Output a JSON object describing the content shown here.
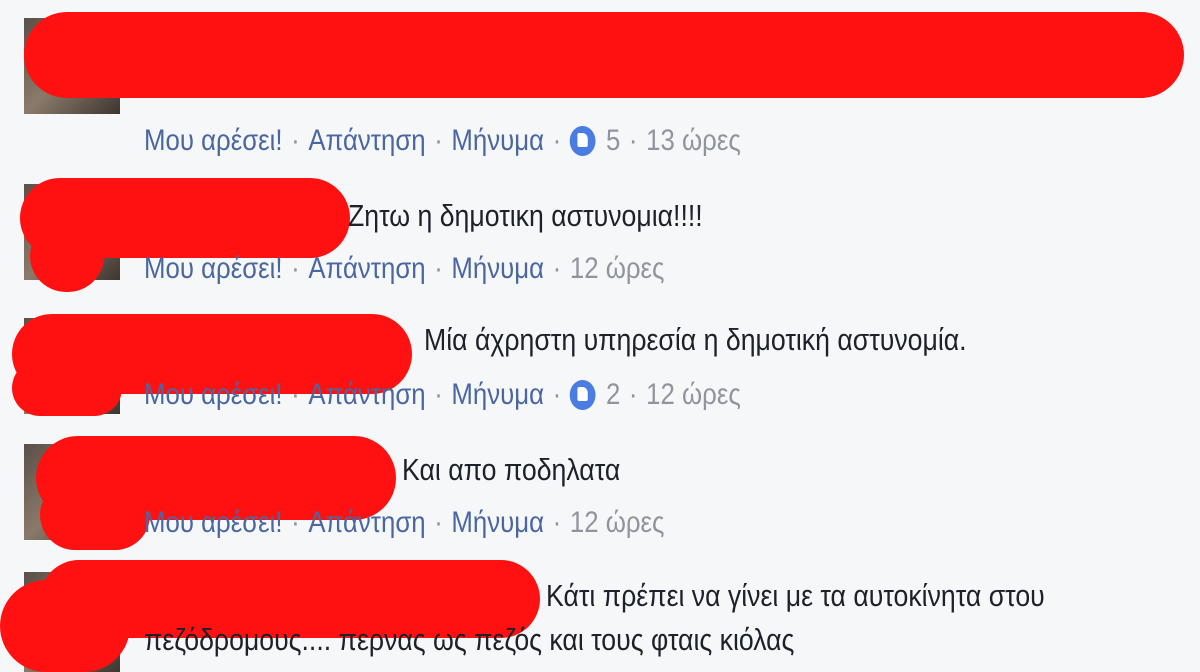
{
  "comments": [
    {
      "text": "",
      "actions": {
        "like": "Μου αρέσει!",
        "reply": "Απάντηση",
        "message": "Μήνυμα"
      },
      "likes": "5",
      "time": "13 ώρες"
    },
    {
      "text": "Ζητω η δημοτικη αστυνομια!!!!",
      "actions": {
        "like": "Μου αρέσει!",
        "reply": "Απάντηση",
        "message": "Μήνυμα"
      },
      "likes": "",
      "time": "12 ώρες"
    },
    {
      "text": "Μία άχρηστη υπηρεσία η δημοτική αστυνομία.",
      "actions": {
        "like": "Μου αρέσει!",
        "reply": "Απάντηση",
        "message": "Μήνυμα"
      },
      "likes": "2",
      "time": "12 ώρες"
    },
    {
      "text": "Και απο ποδηλατα",
      "actions": {
        "like": "Μου αρέσει!",
        "reply": "Απάντηση",
        "message": "Μήνυμα"
      },
      "likes": "",
      "time": "12 ώρες"
    },
    {
      "text": "Κάτι πρέπει να γίνει με τα αυτοκίνητα στου",
      "text_line2": "πεζόδρομους.... περνας ως πεζός και τους φταις κιόλας",
      "likes": "",
      "time": ""
    }
  ],
  "colors": {
    "redaction": "#ff1111",
    "link": "#4b67a1",
    "meta": "#90949c",
    "like_badge": "#4a7de2"
  },
  "icons": [
    "like-thumb-icon"
  ]
}
